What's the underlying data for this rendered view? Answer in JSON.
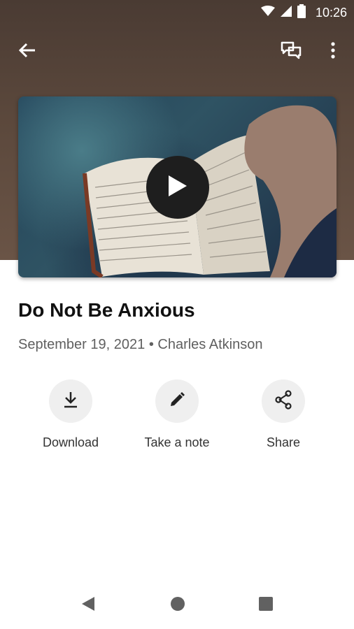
{
  "status_bar": {
    "time": "10:26"
  },
  "app_bar": {
    "back_icon": "arrow-left",
    "chat_icon": "chat-bubbles",
    "more_icon": "more-vertical"
  },
  "video": {
    "play_icon": "play",
    "thumbnail": "open-bible-photo"
  },
  "sermon": {
    "title": "Do Not Be Anxious",
    "date": "September 19, 2021",
    "separator": "•",
    "speaker": "Charles Atkinson"
  },
  "actions": [
    {
      "label": "Download",
      "icon": "download-icon"
    },
    {
      "label": "Take a note",
      "icon": "pencil-icon"
    },
    {
      "label": "Share",
      "icon": "share-icon"
    }
  ],
  "nav": {
    "back": "triangle-back",
    "home": "circle-home",
    "recents": "square-recents"
  },
  "colors": {
    "hero": "#5b483c",
    "circle_bg": "#efefef",
    "play_bg": "#1e1e1e"
  }
}
